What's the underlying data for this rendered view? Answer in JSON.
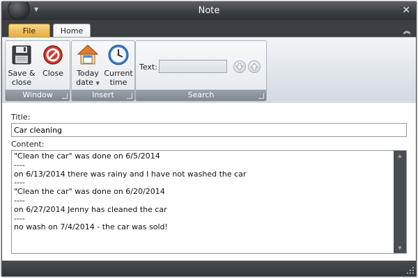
{
  "window": {
    "title": "Note"
  },
  "tabs": [
    {
      "label": "File"
    },
    {
      "label": "Home"
    }
  ],
  "ribbon": {
    "window_group": {
      "label": "Window",
      "save_close": {
        "line1": "Save &",
        "line2": "close",
        "icon": "floppy-disk-icon"
      },
      "close": {
        "label": "Close",
        "icon": "close-circle-icon"
      }
    },
    "insert_group": {
      "label": "Insert",
      "today_date": {
        "line1": "Today",
        "line2": "date",
        "icon": "house-calendar-icon"
      },
      "current_time": {
        "line1": "Current",
        "line2": "time",
        "icon": "clock-icon"
      }
    },
    "search_group": {
      "label": "Search",
      "text_label": "Text:",
      "text_value": "",
      "next_icon": "arrow-down-icon",
      "prev_icon": "arrow-up-icon"
    }
  },
  "note": {
    "title_label": "Title:",
    "title_value": "Car cleaning",
    "content_label": "Content:",
    "content_lines": [
      "\"Clean the car\" was done on 6/5/2014",
      "----",
      "on 6/13/2014 there was rainy and I have not washed the car",
      "----",
      "\"Clean the car\" was done on 6/20/2014",
      "----",
      "on 6/27/2014 Jenny has cleaned the car",
      "----",
      "no wash on 7/4/2014 - the car was sold!"
    ]
  },
  "colors": {
    "file_tab": "#e8a83a",
    "chrome": "#3c3f43",
    "close_icon": "#d9342b",
    "clock_icon": "#3a7fd0"
  }
}
